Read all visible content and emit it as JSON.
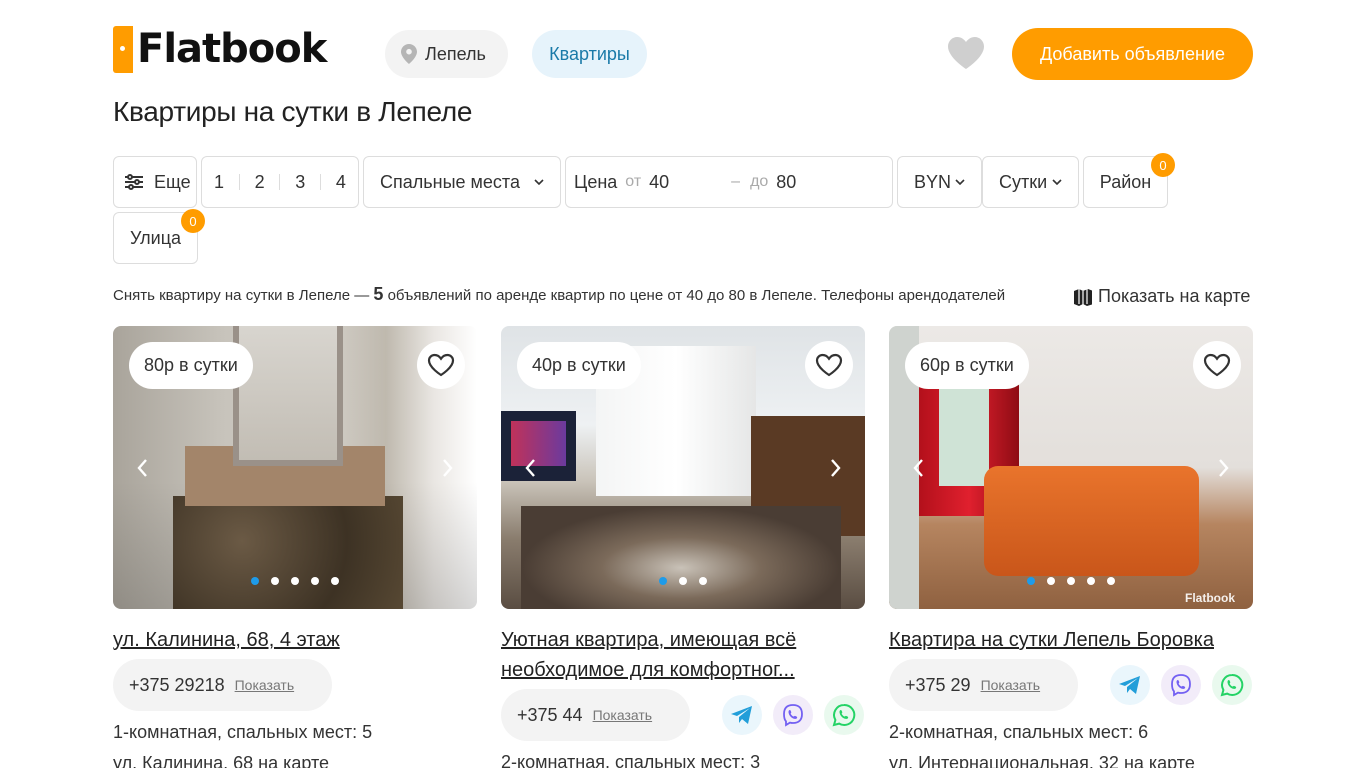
{
  "brand": {
    "name": "Flatbook"
  },
  "header": {
    "city": "Лепель",
    "type": "Квартиры",
    "add_button": "Добавить объявление"
  },
  "page_title": "Квартиры на сутки в Лепеле",
  "filters": {
    "more": "Еще",
    "rooms": [
      "1",
      "2",
      "3",
      "4"
    ],
    "beds": "Спальные места",
    "price_label": "Цена",
    "from_label": "от",
    "from_value": "40",
    "dash": "–",
    "to_label": "до",
    "to_value": "80",
    "currency": "BYN",
    "period": "Сутки",
    "district": "Район",
    "district_count": "0",
    "street": "Улица",
    "street_count": "0"
  },
  "summary": {
    "prefix": "Снять квартиру на сутки в Лепеле —",
    "count": "5",
    "suffix": "объявлений по аренде квартир по цене от 40 до 80 в Лепеле. Телефоны арендодателей"
  },
  "map_link": "Показать на карте",
  "listings": [
    {
      "price": "80р в сутки",
      "title": "ул. Калинина, 68, 4 этаж",
      "phone": "+375 29218",
      "show": "Показать",
      "details": "1-комнатная, спальных мест: 5",
      "address": "ул. Калинина, 68",
      "map": "на карте",
      "dots": 5,
      "active_dot": 0
    },
    {
      "price": "40р в сутки",
      "title": "Уютная квартира, имеющая всё необходимое для комфортног...",
      "phone": "+375 44",
      "show": "Показать",
      "details": "2-комнатная, спальных мест: 3",
      "dots": 3,
      "active_dot": 0
    },
    {
      "price": "60р в сутки",
      "title": "Квартира на сутки Лепель Боровка",
      "phone": "+375 29",
      "show": "Показать",
      "details": "2-комнатная, спальных мест: 6",
      "address": "ул. Интернациональная, 32",
      "map": "на карте",
      "watermark": "Flatbook",
      "dots": 5,
      "active_dot": 0
    }
  ],
  "colors": {
    "accent": "#ff9c00",
    "link_blue": "#1a7aa8",
    "dot_active": "#1e9be9"
  }
}
